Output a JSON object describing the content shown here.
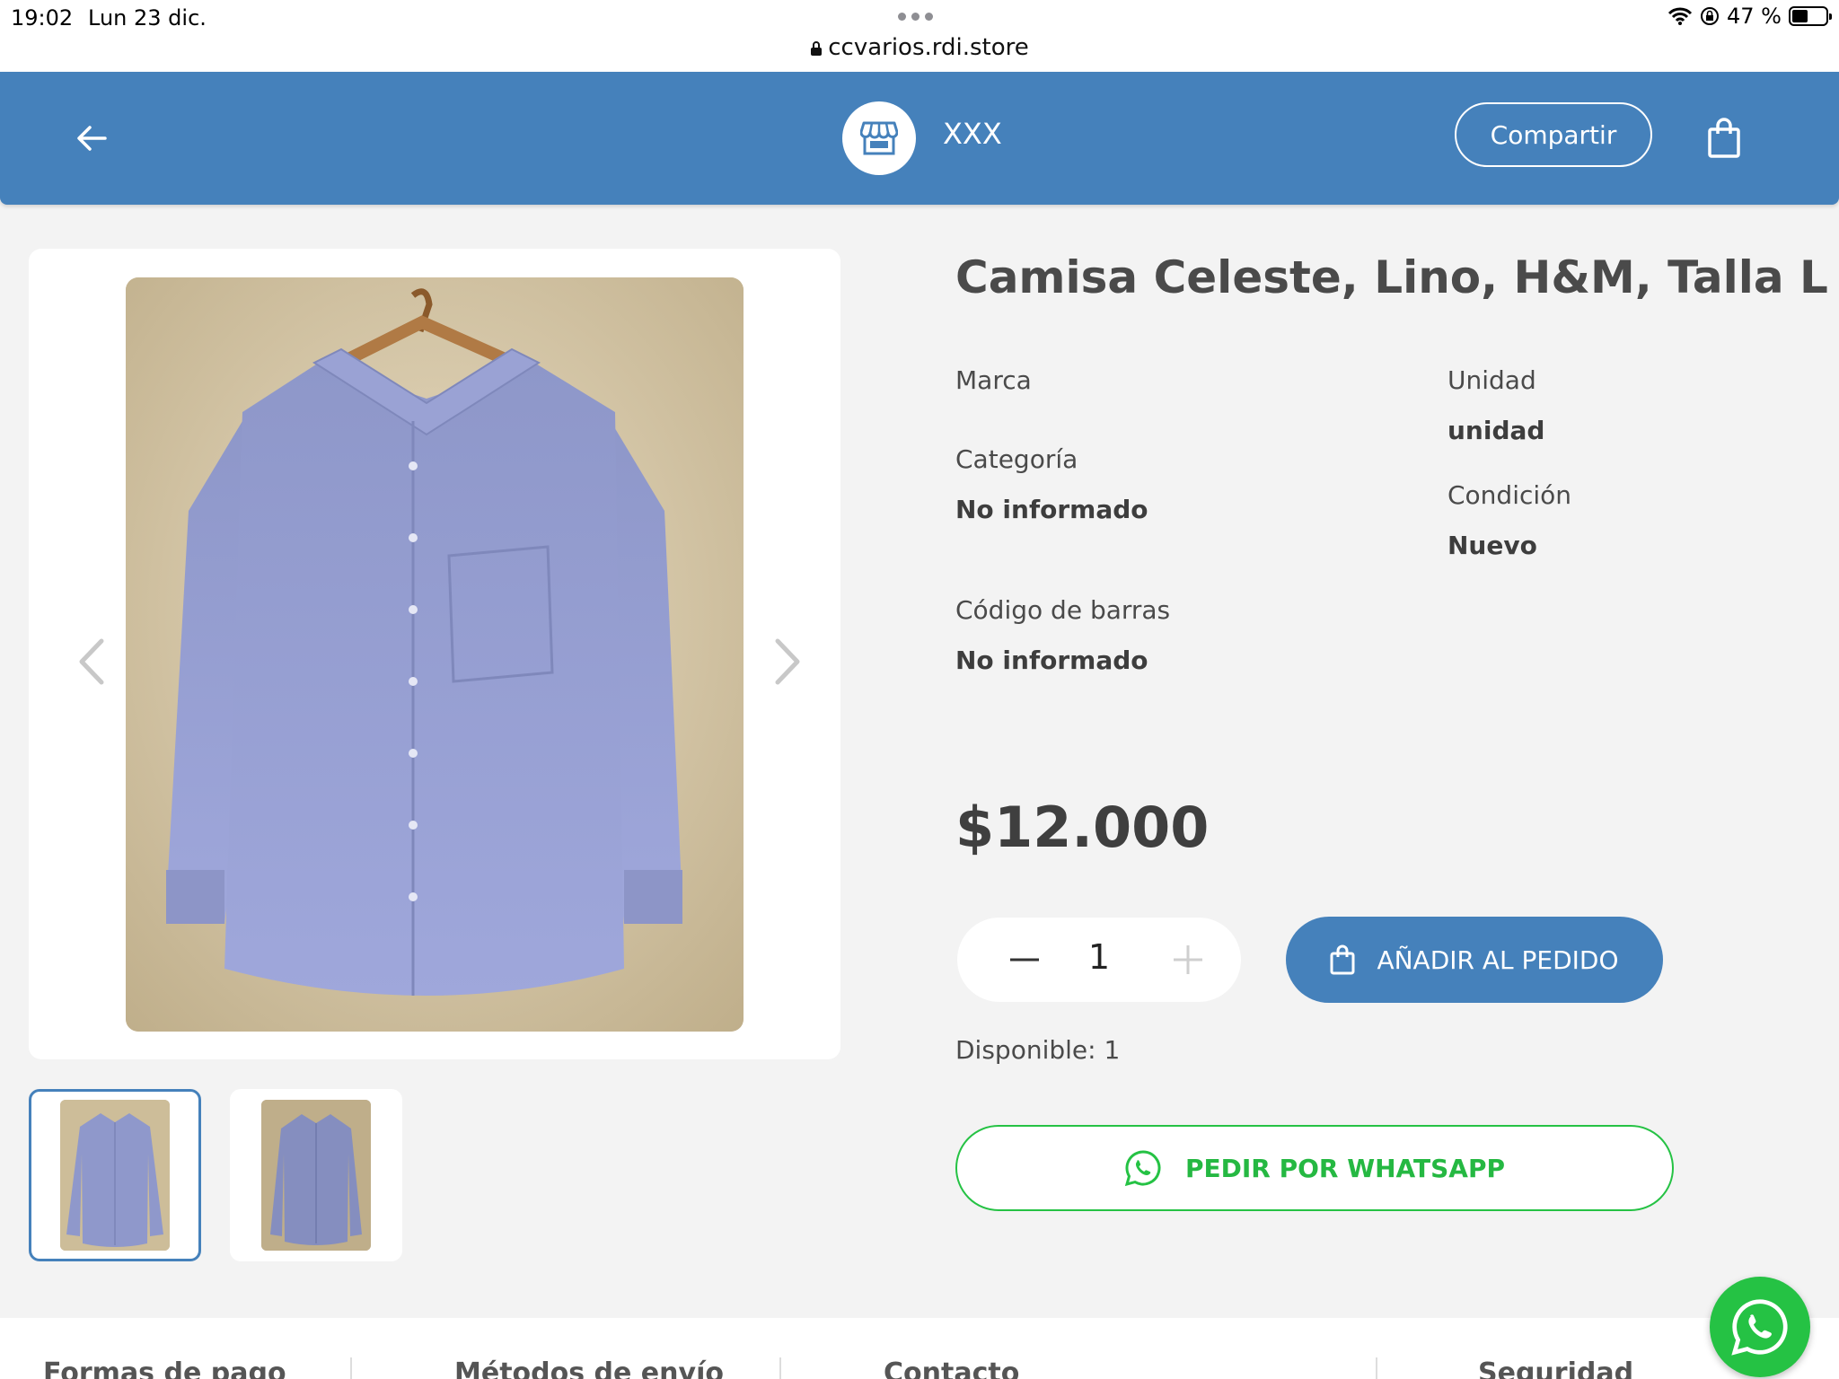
{
  "status_bar": {
    "time": "19:02",
    "date": "Lun 23 dic.",
    "url": "ccvarios.rdi.store",
    "battery": "47 %",
    "battery_level": 0.47
  },
  "header": {
    "store_name": "XXX",
    "share_label": "Compartir",
    "icons": [
      "back-arrow-icon",
      "store-icon",
      "shopping-bag-icon"
    ],
    "background_color": "#4581bb"
  },
  "gallery": {
    "images": [
      "camisa-celeste-front",
      "camisa-celeste-alt"
    ],
    "selected_index": 0
  },
  "product": {
    "title": "Camisa Celeste, Lino, H&M, Talla L",
    "attributes": {
      "marca_label": "Marca",
      "categoria_label": "Categoría",
      "categoria_value": "No informado",
      "codigo_label": "Código de barras",
      "codigo_value": "No informado",
      "unidad_label": "Unidad",
      "unidad_value": "unidad",
      "condicion_label": "Condición",
      "condicion_value": "Nuevo"
    },
    "price": "$12.000",
    "quantity": "1",
    "add_button": "AÑADIR AL PEDIDO",
    "available": "Disponible: 1",
    "whatsapp_button": "PEDIR POR WHATSAPP"
  },
  "footer": {
    "columns": [
      "Formas de pago",
      "Métodos de envío",
      "Contacto",
      "Seguridad"
    ]
  },
  "colors": {
    "primary": "#4581bb",
    "whatsapp": "#25c244",
    "background": "#f3f3f3"
  }
}
